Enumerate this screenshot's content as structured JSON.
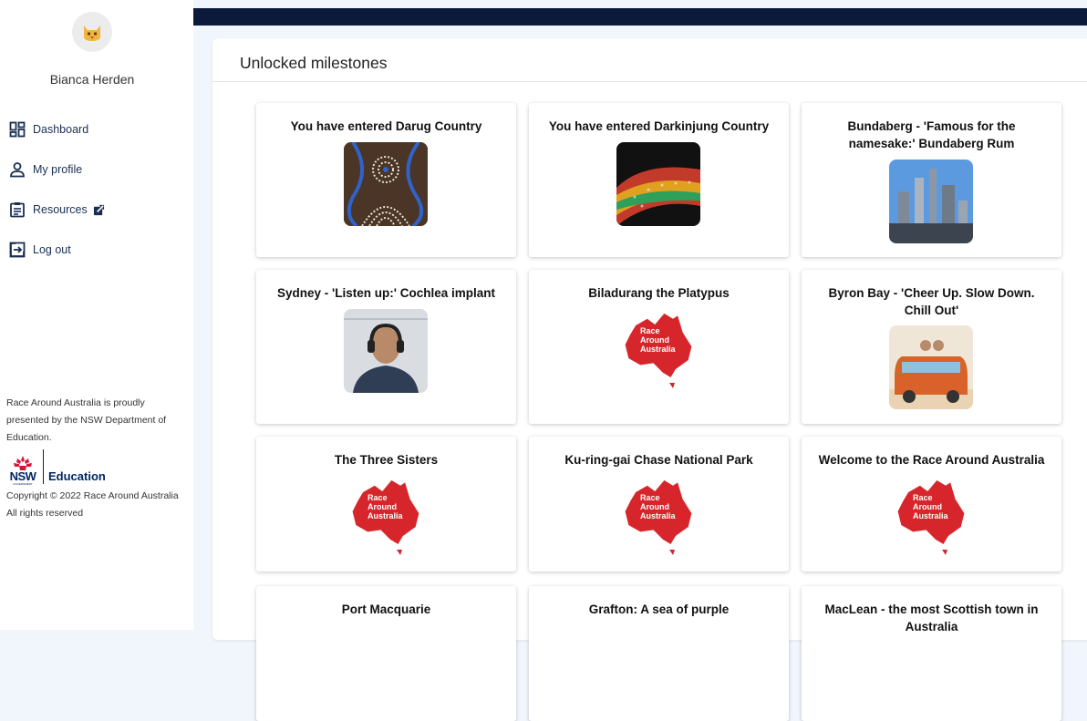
{
  "user": {
    "name": "Bianca Herden"
  },
  "nav": {
    "dashboard": "Dashboard",
    "my_profile": "My profile",
    "resources": "Resources",
    "log_out": "Log out"
  },
  "footer": {
    "presented": "Race Around Australia is proudly presented by the NSW Department of Education.",
    "logo_nsw": "NSW",
    "logo_gov": "GOVERNMENT",
    "logo_edu": "Education",
    "copyright": "Copyright © 2022 Race Around Australia",
    "rights": "All rights reserved"
  },
  "main": {
    "title": "Unlocked milestones",
    "milestones": [
      {
        "title": "You have entered Darug Country"
      },
      {
        "title": "You have entered Darkinjung Country"
      },
      {
        "title": "Bundaberg - 'Famous for the namesake:' Bundaberg Rum"
      },
      {
        "title": "Sydney - 'Listen up:' Cochlea implant"
      },
      {
        "title": "Biladurang the Platypus"
      },
      {
        "title": "Byron Bay - 'Cheer Up. Slow Down. Chill Out'"
      },
      {
        "title": "The Three Sisters"
      },
      {
        "title": "Ku-ring-gai Chase National Park"
      },
      {
        "title": "Welcome to the Race Around Australia"
      },
      {
        "title": "Port Macquarie"
      },
      {
        "title": "Grafton: A sea of purple"
      },
      {
        "title": "MacLean - the most Scottish town in Australia"
      }
    ],
    "map_logo_lines": [
      "Race",
      "Around",
      "Australia"
    ]
  },
  "colors": {
    "topbar": "#0b1a3b",
    "nav_text": "#1a2f54",
    "map_red": "#d7262b"
  }
}
